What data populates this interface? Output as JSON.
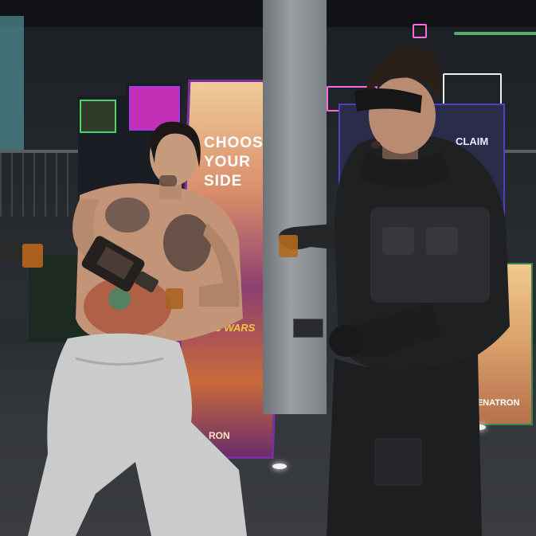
{
  "scene": {
    "poster_main_lines": [
      "CHOOSE",
      "YOUR",
      "SIDE"
    ],
    "poster_subtitle": "...ANG WARS",
    "poster_bottom": "RON",
    "right_poster_label": "DEGENATRON",
    "right_cabinet_label": "CLAIM"
  },
  "colors": {
    "neon_pink": "#ff6adf",
    "neon_white": "#e9f3f5",
    "neon_green": "#5ba86c",
    "poster_border": "#7b2fa0",
    "jacket": "#1e2022",
    "pants": "#c9cccb"
  }
}
